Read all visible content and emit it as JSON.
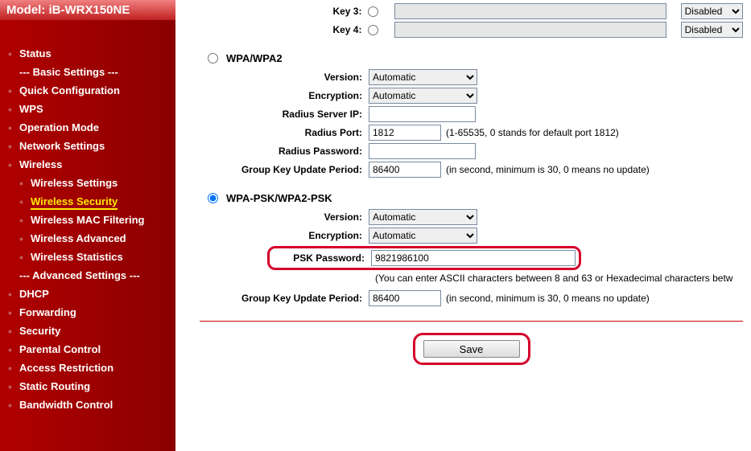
{
  "model": "Model: iB-WRX150NE",
  "nav": {
    "status": "Status",
    "basic_settings": "--- Basic Settings ---",
    "quick_configuration": "Quick Configuration",
    "wps": "WPS",
    "operation_mode": "Operation Mode",
    "network_settings": "Network Settings",
    "wireless": "Wireless",
    "wireless_settings": "Wireless Settings",
    "wireless_security": "Wireless Security",
    "wireless_mac_filtering": "Wireless MAC Filtering",
    "wireless_advanced": "Wireless Advanced",
    "wireless_statistics": "Wireless Statistics",
    "advanced_settings": "--- Advanced Settings ---",
    "dhcp": "DHCP",
    "forwarding": "Forwarding",
    "security": "Security",
    "parental_control": "Parental Control",
    "access_restriction": "Access Restriction",
    "static_routing": "Static Routing",
    "bandwidth_control": "Bandwidth Control"
  },
  "keys": {
    "key3_label": "Key 3:",
    "key4_label": "Key 4:",
    "key3_value": "",
    "key4_value": "",
    "key3_status": "Disabled",
    "key4_status": "Disabled"
  },
  "wpa": {
    "title": "WPA/WPA2",
    "version_label": "Version:",
    "version_value": "Automatic",
    "encryption_label": "Encryption:",
    "encryption_value": "Automatic",
    "radius_ip_label": "Radius Server IP:",
    "radius_ip_value": "",
    "radius_port_label": "Radius Port:",
    "radius_port_value": "1812",
    "radius_port_note": "(1-65535, 0 stands for default port 1812)",
    "radius_password_label": "Radius Password:",
    "radius_password_value": "",
    "group_key_label": "Group Key Update Period:",
    "group_key_value": "86400",
    "group_key_note": "(in second, minimum is 30, 0 means no update)"
  },
  "psk": {
    "title": "WPA-PSK/WPA2-PSK",
    "version_label": "Version:",
    "version_value": "Automatic",
    "encryption_label": "Encryption:",
    "encryption_value": "Automatic",
    "password_label": "PSK Password:",
    "password_value": "9821986100",
    "password_note": "(You can enter ASCII characters between 8 and 63 or Hexadecimal characters betw",
    "group_key_label": "Group Key Update Period:",
    "group_key_value": "86400",
    "group_key_note": "(in second, minimum is 30, 0 means no update)"
  },
  "save_label": "Save"
}
